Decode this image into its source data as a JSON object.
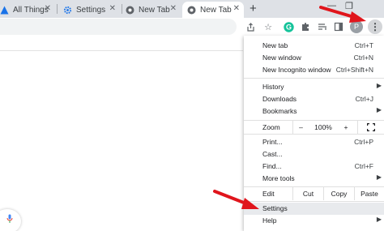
{
  "tabs": [
    {
      "label": "All Things",
      "icon": "site-favicon-icon"
    },
    {
      "label": "Settings",
      "icon": "gear-icon"
    },
    {
      "label": "New Tab",
      "icon": "chrome-icon"
    },
    {
      "label": "New Tab",
      "icon": "chrome-icon",
      "active": true
    }
  ],
  "toolbar": {
    "profile_initial": "P"
  },
  "menu": {
    "new_tab": {
      "label": "New tab",
      "shortcut": "Ctrl+T"
    },
    "new_window": {
      "label": "New window",
      "shortcut": "Ctrl+N"
    },
    "new_incognito": {
      "label": "New Incognito window",
      "shortcut": "Ctrl+Shift+N"
    },
    "history": {
      "label": "History"
    },
    "downloads": {
      "label": "Downloads",
      "shortcut": "Ctrl+J"
    },
    "bookmarks": {
      "label": "Bookmarks"
    },
    "zoom": {
      "label": "Zoom",
      "minus": "–",
      "value": "100%",
      "plus": "+"
    },
    "print": {
      "label": "Print...",
      "shortcut": "Ctrl+P"
    },
    "cast": {
      "label": "Cast..."
    },
    "find": {
      "label": "Find...",
      "shortcut": "Ctrl+F"
    },
    "more_tools": {
      "label": "More tools"
    },
    "edit": {
      "label": "Edit",
      "cut": "Cut",
      "copy": "Copy",
      "paste": "Paste"
    },
    "settings": {
      "label": "Settings"
    },
    "help": {
      "label": "Help"
    }
  },
  "colors": {
    "annotation_arrow": "#e0151c",
    "highlight": "#e8eaed",
    "grammarly": "#15c39a",
    "google_blue": "#4285f4"
  }
}
